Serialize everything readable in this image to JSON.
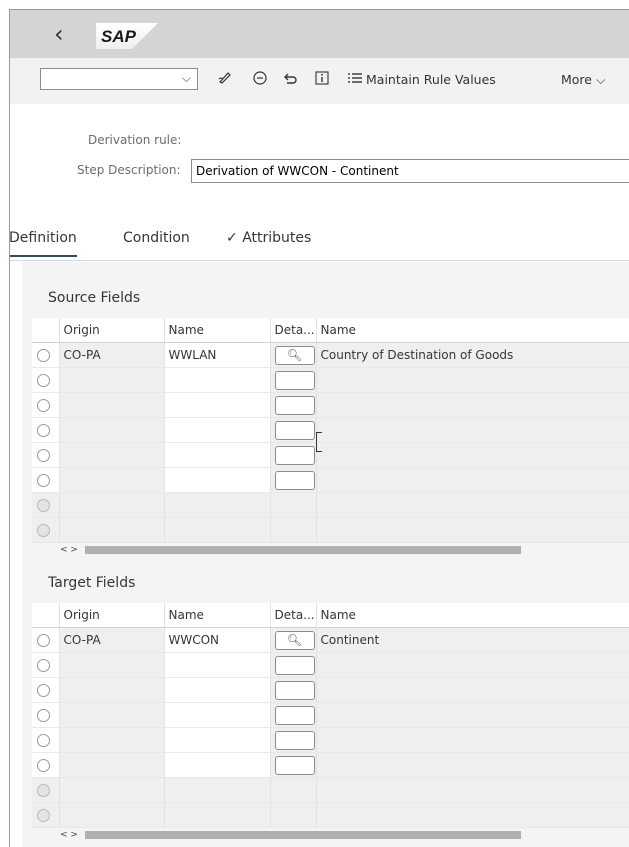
{
  "shell": {
    "back_icon": "chevron-left-icon",
    "logo": "SAP"
  },
  "toolbar": {
    "select_value": "",
    "icons": [
      "edit-icon",
      "minus-circle-icon",
      "undo-icon",
      "info-icon",
      "list-icon"
    ],
    "maintain_rule_values": "Maintain Rule Values",
    "more": "More"
  },
  "form": {
    "derivation_rule_label": "Derivation rule:",
    "derivation_rule_value": "",
    "step_description_label": "Step Description:",
    "step_description_value": "Derivation of WWCON - Continent"
  },
  "tabs": [
    {
      "label": "Definition",
      "selected": true
    },
    {
      "label": "Condition",
      "selected": false
    },
    {
      "label": "Attributes",
      "selected": false,
      "check": "✓"
    }
  ],
  "source_fields": {
    "title": "Source Fields",
    "columns": [
      "Origin",
      "Name",
      "Deta...",
      "Name"
    ],
    "rows": [
      {
        "origin": "CO-PA",
        "name": "WWLAN",
        "detail_icon": "search-icon",
        "description": "Country of Destination of Goods"
      }
    ]
  },
  "target_fields": {
    "title": "Target Fields",
    "columns": [
      "Origin",
      "Name",
      "Deta...",
      "Name"
    ],
    "rows": [
      {
        "origin": "CO-PA",
        "name": "WWCON",
        "detail_icon": "search-icon",
        "description": "Continent"
      }
    ]
  },
  "scroll_arrows": "< >"
}
